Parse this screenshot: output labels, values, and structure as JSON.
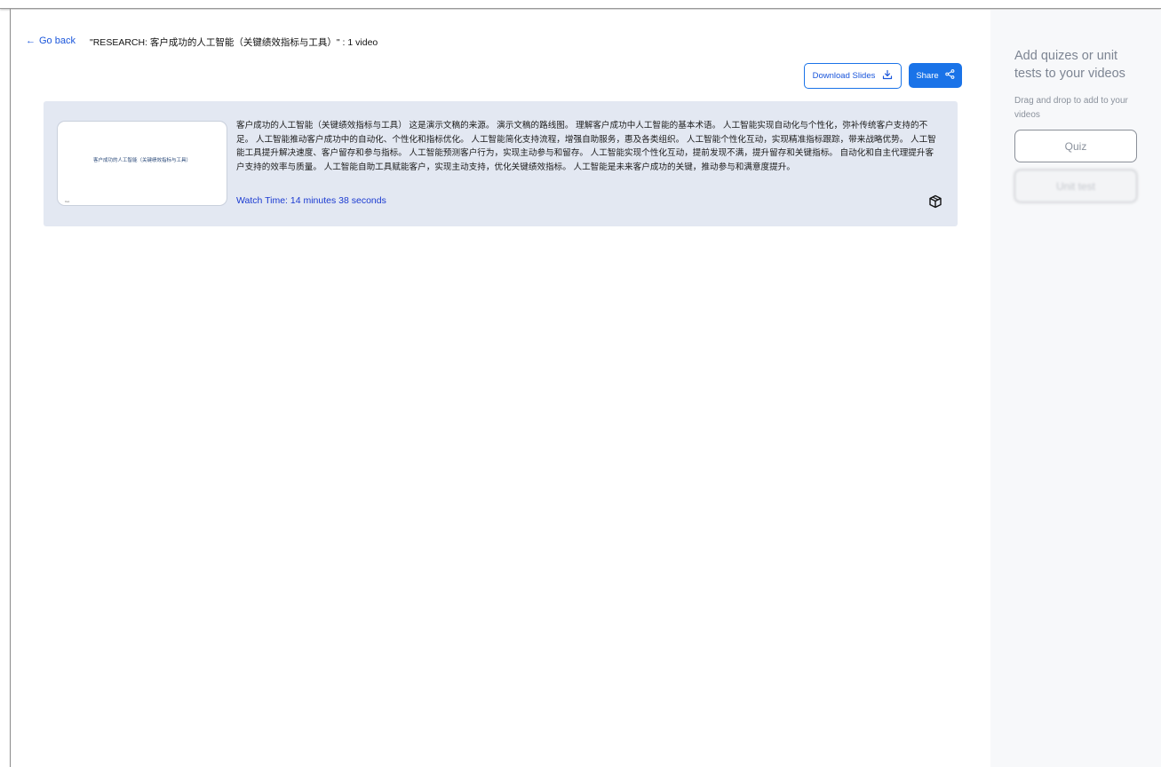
{
  "header": {
    "back_label": "Go back",
    "back_icon": "arrow-left-icon",
    "title": "\"RESEARCH: 客户成功的人工智能（关键绩效指标与工具）\" : 1 video"
  },
  "toolbar": {
    "download_label": "Download Slides",
    "download_icon": "download-icon",
    "share_label": "Share",
    "share_icon": "share-icon",
    "accent_color": "#1a73e8"
  },
  "videos": [
    {
      "thumbnail_title": "客户成功的人工智能（关键绩效指标与工具）",
      "thumbnail_corner": "Cal..",
      "description": "客户成功的人工智能（关键绩效指标与工具） 这是演示文稿的来源。 演示文稿的路线图。 理解客户成功中人工智能的基本术语。 人工智能实现自动化与个性化，弥补传统客户支持的不足。 人工智能推动客户成功中的自动化、个性化和指标优化。 人工智能简化支持流程，增强自助服务，惠及各类组织。 人工智能个性化互动，实现精准指标跟踪，带来战略优势。 人工智能工具提升解决速度、客户留存和参与指标。 人工智能预测客户行为，实现主动参与和留存。 人工智能实现个性化互动，提前发现不满，提升留存和关键指标。 自动化和自主代理提升客户支持的效率与质量。 人工智能自助工具赋能客户，实现主动支持，优化关键绩效指标。 人工智能是未来客户成功的关键，推动参与和满意度提升。",
      "watch_time": "Watch Time: 14 minutes 38 seconds",
      "action_icon": "cube-icon"
    }
  ],
  "sidebar": {
    "heading": "Add quizes or unit tests to your videos",
    "subheading": "Drag and drop to add to your videos",
    "quiz_label": "Quiz",
    "unit_test_label": "Unit test"
  }
}
